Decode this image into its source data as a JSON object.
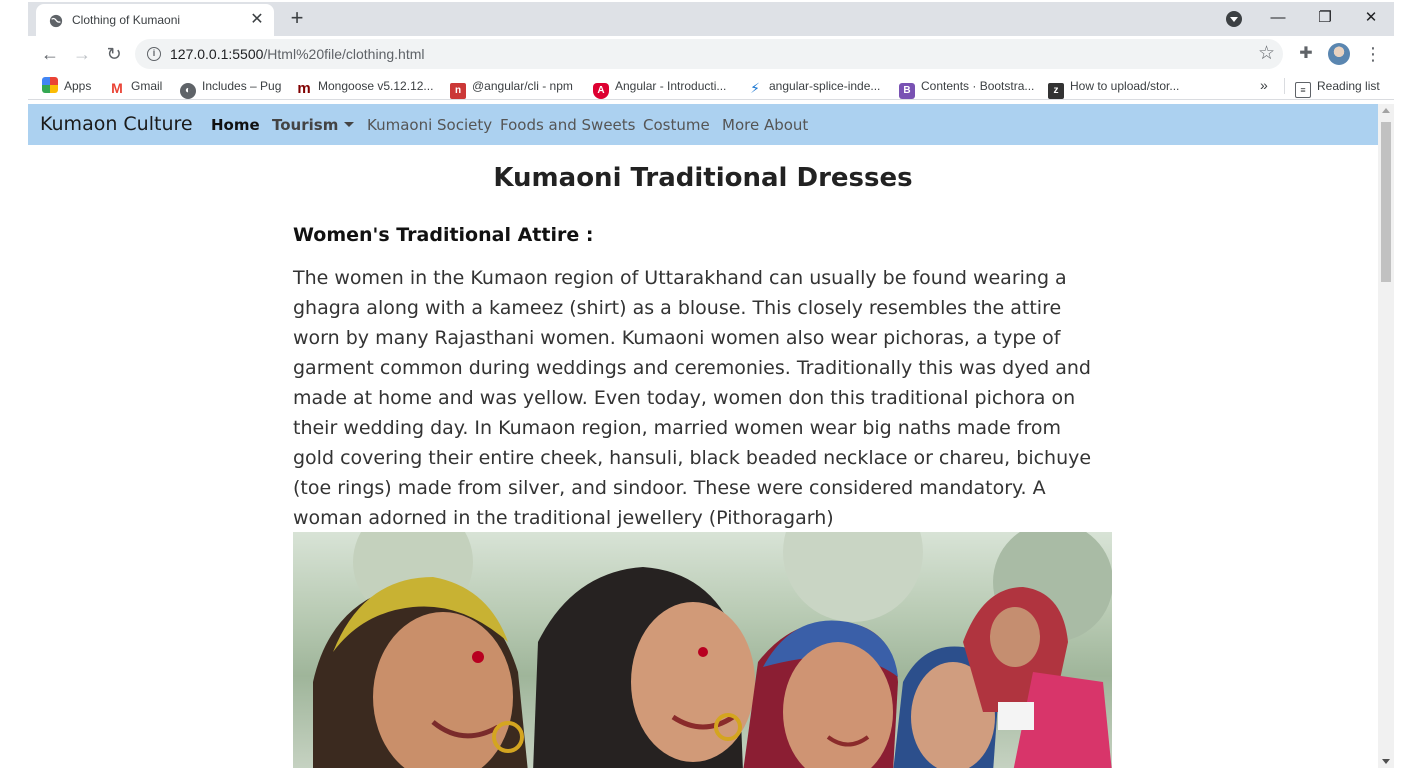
{
  "browser": {
    "tab_title": "Clothing of Kumaoni",
    "url_host": "127.0.0.1:5500",
    "url_path": "/Html%20file/clothing.html",
    "bookmarks": [
      {
        "label": "Apps",
        "icon": "apps-grid-icon",
        "color": "#ea4335"
      },
      {
        "label": "Gmail",
        "icon": "gmail-icon",
        "color": "#ea4335"
      },
      {
        "label": "Includes – Pug",
        "icon": "globe-icon",
        "color": "#5f6368"
      },
      {
        "label": "Mongoose v5.12.12...",
        "icon": "mongoose-icon",
        "color": "#800000"
      },
      {
        "label": "@angular/cli - npm",
        "icon": "npm-icon",
        "color": "#cb3837"
      },
      {
        "label": "Angular - Introducti...",
        "icon": "angular-icon",
        "color": "#dd0031"
      },
      {
        "label": "angular-splice-inde...",
        "icon": "bolt-icon",
        "color": "#1976d2"
      },
      {
        "label": "Contents · Bootstra...",
        "icon": "bootstrap-icon",
        "color": "#7952b3"
      },
      {
        "label": "How to upload/stor...",
        "icon": "z-icon",
        "color": "#333333"
      }
    ],
    "more_label": "»",
    "reading_list": "Reading list"
  },
  "site": {
    "brand": "Kumaon Culture",
    "nav": [
      {
        "label": "Home",
        "state": "active"
      },
      {
        "label": "Tourism",
        "state": "dropdown"
      },
      {
        "label": "Kumaoni Society",
        "state": "normal"
      },
      {
        "label": "Foods and Sweets",
        "state": "normal"
      },
      {
        "label": "Costume",
        "state": "normal"
      },
      {
        "label": "More About",
        "state": "normal"
      }
    ],
    "navbar_color": "#acd1f0"
  },
  "page": {
    "title": "Kumaoni Traditional Dresses",
    "section_heading": "Women's Traditional Attire :",
    "paragraph": "The women in the Kumaon region of Uttarakhand can usually be found wearing a ghagra along with a kameez (shirt) as a blouse. This closely resembles the attire worn by many Rajasthani women. Kumaoni women also wear pichoras, a type of garment common during weddings and ceremonies. Traditionally this was dyed and made at home and was yellow. Even today, women don this traditional pichora on their wedding day. In Kumaon region, married women wear big naths made from gold covering their entire cheek, hansuli, black beaded necklace or chareu, bichuye (toe rings) made from silver, and sindoor. These were considered mandatory. A woman adorned in the traditional jewellery (Pithoragarh)"
  }
}
